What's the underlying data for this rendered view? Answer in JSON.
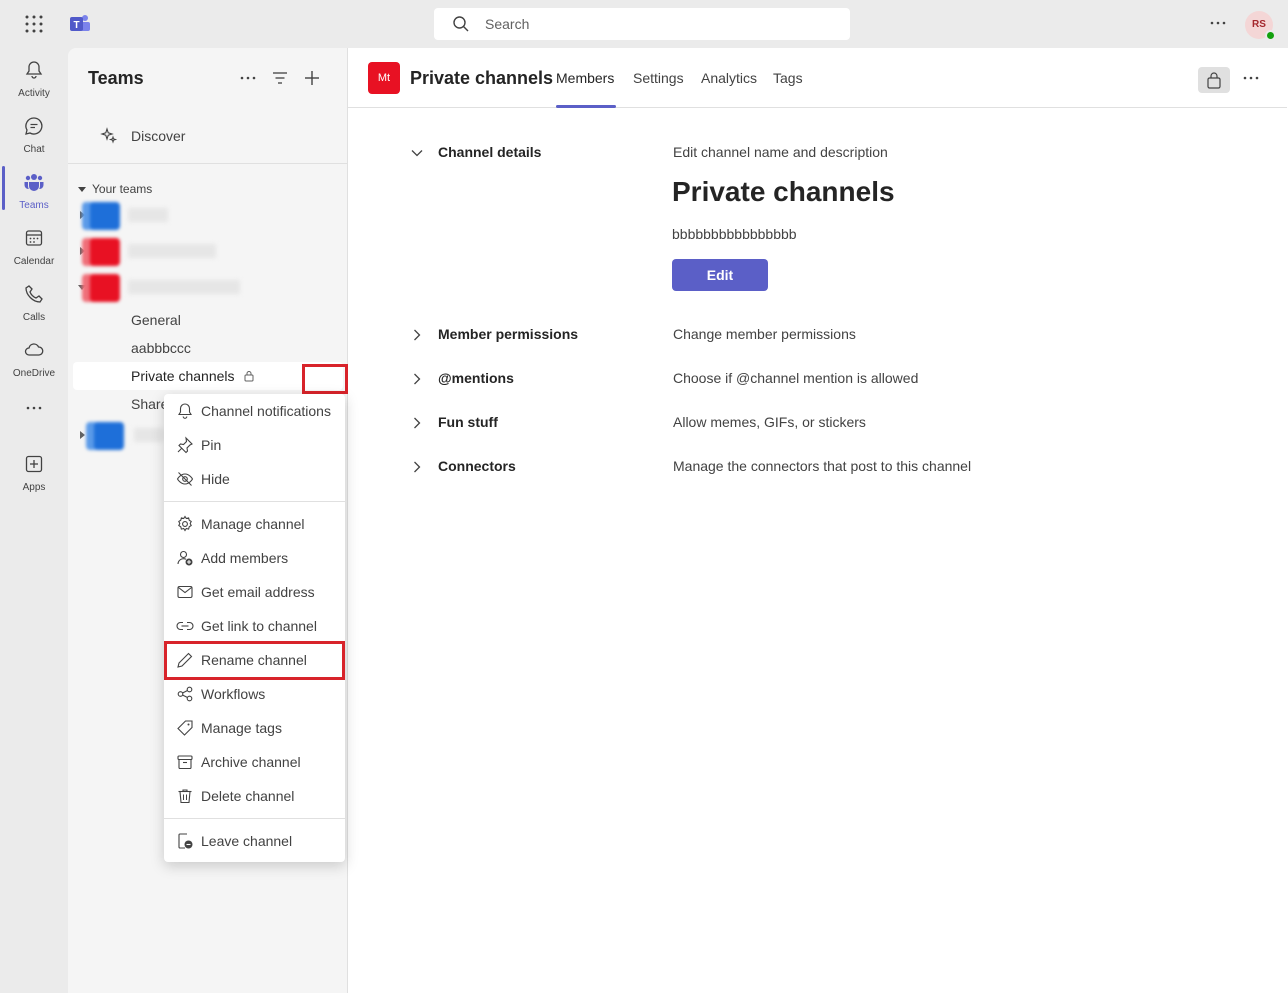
{
  "topbar": {
    "search_placeholder": "Search",
    "avatar_initials": "RS"
  },
  "rail": {
    "items": [
      {
        "label": "Activity",
        "icon": "bell-icon"
      },
      {
        "label": "Chat",
        "icon": "chat-icon"
      },
      {
        "label": "Teams",
        "icon": "teams-icon",
        "active": true
      },
      {
        "label": "Calendar",
        "icon": "calendar-icon"
      },
      {
        "label": "Calls",
        "icon": "phone-icon"
      },
      {
        "label": "OneDrive",
        "icon": "cloud-icon"
      },
      {
        "label": "",
        "icon": "more-icon"
      },
      {
        "label": "Apps",
        "icon": "add-app-icon"
      }
    ]
  },
  "panel": {
    "title": "Teams",
    "discover_label": "Discover",
    "your_teams_label": "Your teams",
    "channels": [
      "General",
      "aabbbccc",
      "Private channels",
      "Share"
    ]
  },
  "context_menu": {
    "items": [
      {
        "label": "Channel notifications",
        "icon": "bell-icon"
      },
      {
        "label": "Pin",
        "icon": "pin-icon"
      },
      {
        "label": "Hide",
        "icon": "eye-off-icon"
      },
      {
        "label": "Manage channel",
        "icon": "gear-icon"
      },
      {
        "label": "Add members",
        "icon": "person-add-icon"
      },
      {
        "label": "Get email address",
        "icon": "mail-icon"
      },
      {
        "label": "Get link to channel",
        "icon": "link-icon"
      },
      {
        "label": "Rename channel",
        "icon": "pencil-icon"
      },
      {
        "label": "Workflows",
        "icon": "workflow-icon"
      },
      {
        "label": "Manage tags",
        "icon": "tag-icon"
      },
      {
        "label": "Archive channel",
        "icon": "archive-icon"
      },
      {
        "label": "Delete channel",
        "icon": "trash-icon"
      },
      {
        "label": "Leave channel",
        "icon": "leave-icon"
      }
    ]
  },
  "main": {
    "channel_avatar": "Mt",
    "title": "Private channels",
    "tabs": [
      "Members",
      "Settings",
      "Analytics",
      "Tags"
    ],
    "active_tab": "Members",
    "sections": {
      "channel_details": {
        "heading": "Channel details",
        "description": "Edit channel name and description",
        "channel_name": "Private channels",
        "channel_description": "bbbbbbbbbbbbbbbb",
        "edit_label": "Edit"
      },
      "member_permissions": {
        "heading": "Member permissions",
        "description": "Change member permissions"
      },
      "mentions": {
        "heading": "@mentions",
        "description": "Choose if @channel mention is allowed"
      },
      "fun_stuff": {
        "heading": "Fun stuff",
        "description": "Allow memes, GIFs, or stickers"
      },
      "connectors": {
        "heading": "Connectors",
        "description": "Manage the connectors that post to this channel"
      }
    }
  },
  "colors": {
    "accent": "#5b5fc7",
    "highlight_box": "#d8232a",
    "team_red": "#e81123",
    "team_blue": "#1e6fd9"
  }
}
